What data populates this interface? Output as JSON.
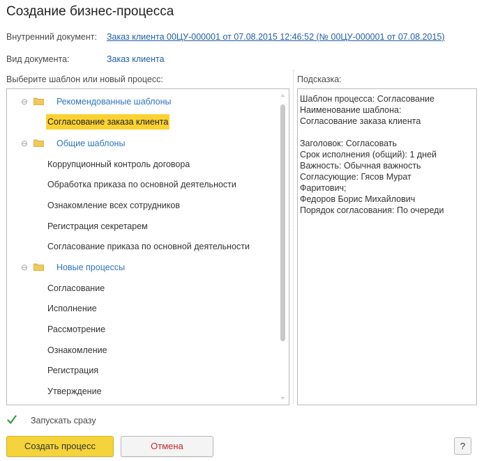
{
  "window": {
    "title": "Создание бизнес-процесса"
  },
  "fields": {
    "internal_doc_label": "Внутренний документ:",
    "internal_doc_value": "Заказ клиента 00ЦУ-000001 от 07.08.2015 12:46:52 (№ 00ЦУ-000001 от 07.08.2015)",
    "doc_type_label": "Вид документа:",
    "doc_type_value": "Заказ клиента"
  },
  "tree": {
    "label": "Выберите шаблон или новый процесс:",
    "groups": [
      {
        "name": "Рекомендованные шаблоны",
        "items": [
          "Согласование заказа клиента"
        ]
      },
      {
        "name": "Общие шаблоны",
        "items": [
          "Коррупционный контроль договора",
          "Обработка приказа по основной деятельности",
          "Ознакомление всех сотрудников",
          "Регистрация секретарем",
          "Согласование приказа по основной деятельности"
        ]
      },
      {
        "name": "Новые процессы",
        "items": [
          "Согласование",
          "Исполнение",
          "Рассмотрение",
          "Ознакомление",
          "Регистрация",
          "Утверждение"
        ]
      }
    ],
    "selected": "Согласование заказа клиента",
    "collapse_glyph": "⊖"
  },
  "hint": {
    "label": "Подсказка:",
    "lines": [
      "Шаблон процесса: Согласование",
      "Наименование шаблона:",
      "Согласование заказа клиента",
      "",
      "Заголовок: Согласовать",
      "Срок исполнения (общий): 1 дней",
      "Важность: Обычная важность",
      "Согласующие: Гясов Мурат",
      "Фаритович;",
      "Федоров Борис Михайлович",
      "Порядок согласования: По очереди"
    ]
  },
  "options": {
    "start_now_label": "Запускать сразу",
    "start_now_checked": true
  },
  "buttons": {
    "create": "Создать процесс",
    "cancel": "Отмена",
    "help": "?"
  },
  "colors": {
    "accent": "#f5d33b",
    "link": "#1f5ea8",
    "group": "#2f74c0",
    "cancel_text": "#c8252b"
  }
}
